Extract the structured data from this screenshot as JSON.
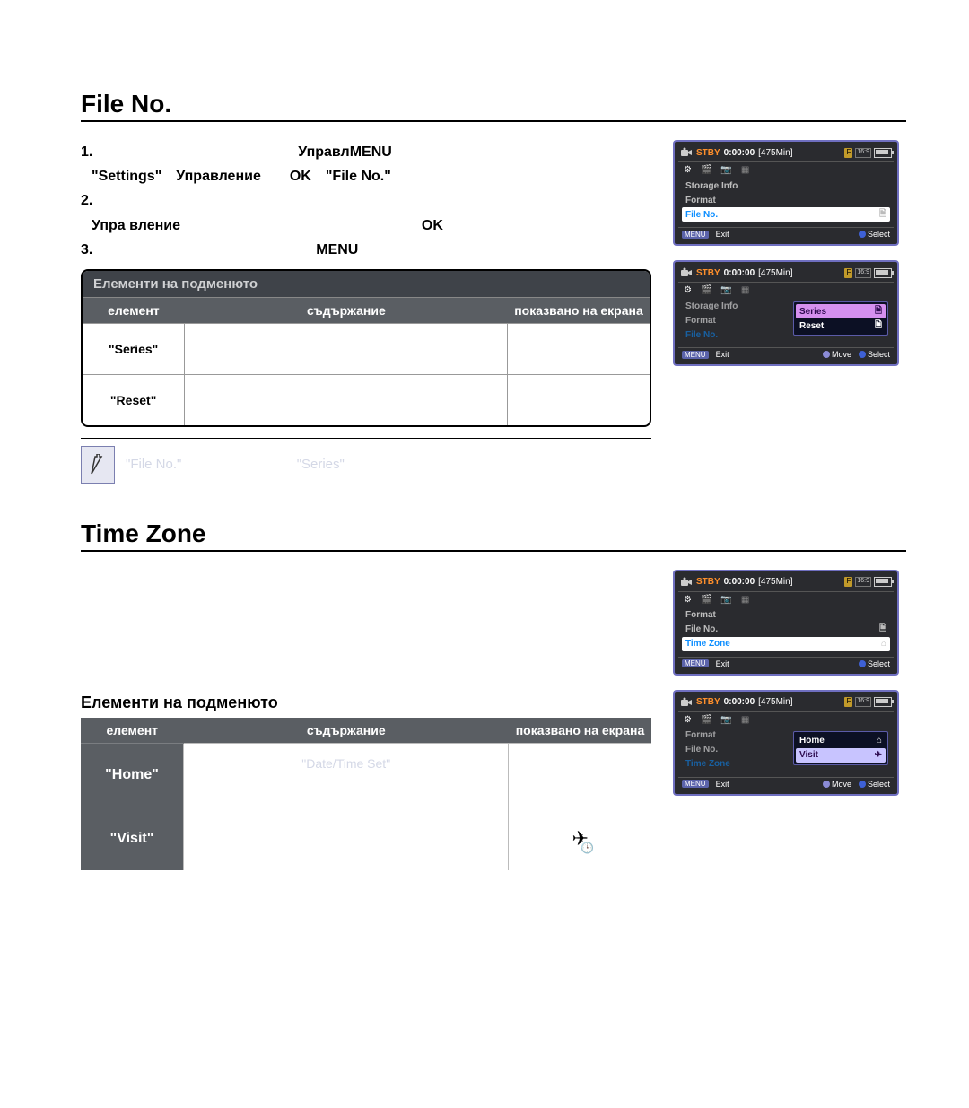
{
  "section1": {
    "title": "File No.",
    "steps": {
      "s1a": "1.",
      "s1b": "Управл",
      "s1b2": "MENU",
      "s2": "\"Settings\" Управление  OK \"File No.\"",
      "s3a": "2.",
      "s3b": "Упра вление",
      "s3c": "OK",
      "s4a": "3.",
      "s4b": "MENU"
    },
    "subbox": {
      "title": "Елементи на подменюто",
      "headers": {
        "h1": "елемент",
        "h2": "съдържание",
        "h3": "показвано на екрана"
      },
      "rows": {
        "r1": "\"Series\"",
        "r2": "\"Reset\""
      }
    },
    "note": {
      "t1": "\"File No.\"",
      "t2": "\"Series\""
    }
  },
  "section2": {
    "title": "Time Zone",
    "subtitle": "Елементи на подменюто",
    "headers": {
      "h1": "елемент",
      "h2": "съдържание",
      "h3": "показвано на екрана"
    },
    "rows": {
      "r1": "\"Home\"",
      "r1b": "\"Date/Time Set\"",
      "r2": "\"Visit\""
    }
  },
  "cam": {
    "stby": "STBY",
    "time": "0:00:00",
    "min": "[475Min]",
    "iconbar": {
      "i1": "⚙",
      "i2": "🎬",
      "i3": "📷",
      "i4": "▦"
    },
    "screen1": {
      "r1": "Storage Info",
      "r2": "Format",
      "r3": "File No.",
      "footer_exit": "Exit",
      "footer_select": "Select"
    },
    "screen2": {
      "r1": "Storage Info",
      "r2": "Format",
      "r3": "File No.",
      "sub1": "Series",
      "sub2": "Reset",
      "footer_exit": "Exit",
      "footer_move": "Move",
      "footer_select": "Select"
    },
    "screen3": {
      "r1": "Format",
      "r2": "File No.",
      "r3": "Time Zone",
      "footer_exit": "Exit",
      "footer_select": "Select"
    },
    "screen4": {
      "r1": "Format",
      "r2": "File No.",
      "r3": "Time Zone",
      "sub1": "Home",
      "sub2": "Visit",
      "footer_exit": "Exit",
      "footer_move": "Move",
      "footer_select": "Select"
    },
    "menu_badge": "MENU"
  }
}
